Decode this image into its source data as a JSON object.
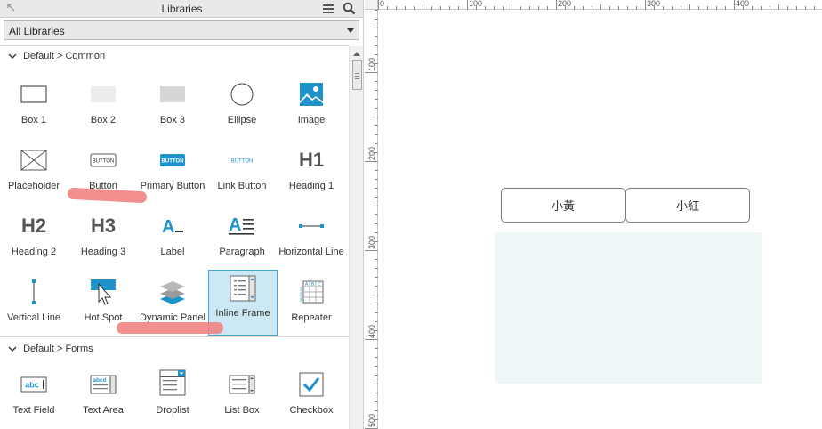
{
  "panel": {
    "title": "Libraries",
    "icons": [
      "collapse-corner-icon",
      "menu-icon",
      "search-icon"
    ],
    "library_select": {
      "selected": "All Libraries"
    }
  },
  "sections": [
    {
      "title": "Default > Common",
      "widgets": [
        {
          "label": "Box 1",
          "icon": "box1-icon"
        },
        {
          "label": "Box 2",
          "icon": "box2-icon"
        },
        {
          "label": "Box 3",
          "icon": "box3-icon"
        },
        {
          "label": "Ellipse",
          "icon": "ellipse-icon"
        },
        {
          "label": "Image",
          "icon": "image-icon"
        },
        {
          "label": "Placeholder",
          "icon": "placeholder-icon"
        },
        {
          "label": "Button",
          "icon": "button-icon",
          "icon_text": "BUTTON"
        },
        {
          "label": "Primary Button",
          "icon": "primary-button-icon",
          "icon_text": "BUTTON"
        },
        {
          "label": "Link Button",
          "icon": "link-button-icon",
          "icon_text": "BUTTON"
        },
        {
          "label": "Heading 1",
          "icon": "heading1-icon",
          "icon_text": "H1"
        },
        {
          "label": "Heading 2",
          "icon": "heading2-icon",
          "icon_text": "H2"
        },
        {
          "label": "Heading 3",
          "icon": "heading3-icon",
          "icon_text": "H3"
        },
        {
          "label": "Label",
          "icon": "label-icon",
          "icon_text": "A"
        },
        {
          "label": "Paragraph",
          "icon": "paragraph-icon",
          "icon_text": "A"
        },
        {
          "label": "Horizontal Line",
          "icon": "horizontal-line-icon"
        },
        {
          "label": "Vertical Line",
          "icon": "vertical-line-icon"
        },
        {
          "label": "Hot Spot",
          "icon": "hot-spot-icon"
        },
        {
          "label": "Dynamic Panel",
          "icon": "dynamic-panel-icon"
        },
        {
          "label": "Inline Frame",
          "icon": "inline-frame-icon",
          "selected": true
        },
        {
          "label": "Repeater",
          "icon": "repeater-icon",
          "icon_text": [
            "A",
            "B",
            "C",
            "1",
            "2",
            "3"
          ]
        }
      ]
    },
    {
      "title": "Default > Forms",
      "widgets": [
        {
          "label": "Text Field",
          "icon": "text-field-icon",
          "icon_text": "abc"
        },
        {
          "label": "Text Area",
          "icon": "text-area-icon",
          "icon_text": "abcd"
        },
        {
          "label": "Droplist",
          "icon": "droplist-icon"
        },
        {
          "label": "List Box",
          "icon": "list-box-icon"
        },
        {
          "label": "Checkbox",
          "icon": "checkbox-icon"
        }
      ]
    }
  ],
  "colors": {
    "accent": "#1e93c9",
    "selection_bg": "#cde8f5",
    "selection_border": "#42a7d6",
    "annotation_mark": "#f08080",
    "dynamic_panel_fill": "#eff6f8"
  },
  "canvas": {
    "ruler_top": [
      "0",
      "100",
      "200",
      "300",
      "400"
    ],
    "ruler_left": [
      "100",
      "200",
      "300",
      "400",
      "500"
    ],
    "buttons": [
      "小黃",
      "小紅"
    ]
  }
}
